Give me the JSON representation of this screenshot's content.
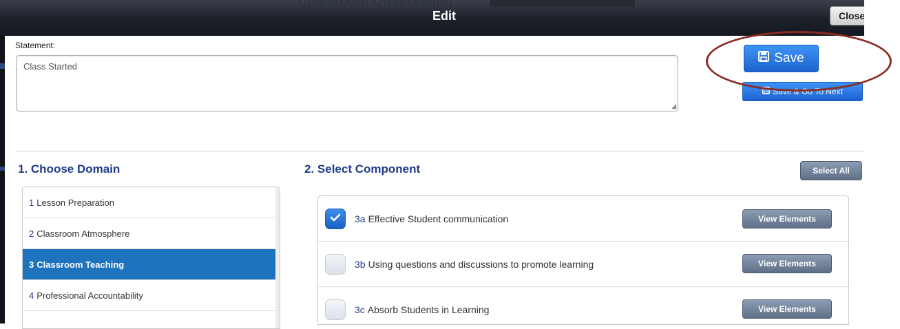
{
  "dialog": {
    "title": "Edit",
    "close_label": "Close",
    "background_title": "Classroom Observation",
    "background_subtitle": ""
  },
  "statement": {
    "label": "Statement:",
    "value": "Class Started"
  },
  "actions": {
    "save_label": "Save",
    "save_next_label": "Save & Go To Next"
  },
  "domain_section": {
    "heading": "1. Choose Domain",
    "items": [
      {
        "num": "1",
        "label": "Lesson Preparation",
        "selected": false
      },
      {
        "num": "2",
        "label": "Classroom Atmosphere",
        "selected": false
      },
      {
        "num": "3",
        "label": "Classroom Teaching",
        "selected": true
      },
      {
        "num": "4",
        "label": "Professional Accountability",
        "selected": false
      }
    ]
  },
  "component_section": {
    "heading": "2. Select Component",
    "select_all_label": "Select All",
    "view_elements_label": "View Elements",
    "items": [
      {
        "code": "3a",
        "label": "Effective Student communication",
        "checked": true
      },
      {
        "code": "3b",
        "label": "Using questions and discussions to promote learning",
        "checked": false
      },
      {
        "code": "3c",
        "label": "Absorb Students in Learning",
        "checked": false
      }
    ]
  },
  "colors": {
    "primary_button": "#1e62d0",
    "active_item": "#1e73be",
    "heading": "#1f3a8a",
    "annotation": "#8b2b22"
  },
  "icons": [
    "floppy-disk-icon",
    "checkmark-icon"
  ]
}
